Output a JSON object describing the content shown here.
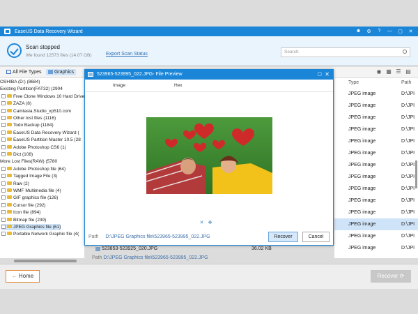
{
  "window": {
    "title": "EaseUS Data Recovery Wizard",
    "controls": [
      "☻",
      "⚙",
      "?",
      "—",
      "▢",
      "✕"
    ]
  },
  "scan": {
    "status": "Scan stopped",
    "summary": "We found 12573 files (14.07 GB)",
    "export_label": "Export Scan Status"
  },
  "search": {
    "placeholder": "Search"
  },
  "tabs": {
    "all": "All File Types",
    "graphics": "Graphics"
  },
  "tree": [
    {
      "label": "OSHIBA (D:) (8684)",
      "level": 0,
      "folder": false
    },
    {
      "label": "Existing Partition(FAT32) (2904",
      "level": 0,
      "folder": false
    },
    {
      "label": "Free Clone Windows 10 Hard Drive t",
      "level": 2,
      "folder": true
    },
    {
      "label": "ZAZA (8)",
      "level": 2,
      "folder": true
    },
    {
      "label": "Camtasia.Studio_xp510.com",
      "level": 2,
      "folder": true
    },
    {
      "label": "Other lost files (1116)",
      "level": 2,
      "folder": true
    },
    {
      "label": "Todo Backup (1184)",
      "level": 2,
      "folder": true
    },
    {
      "label": "EaseUS Data Recovery Wizard (",
      "level": 2,
      "folder": true
    },
    {
      "label": "EaseUS Partition Master 10.5 (28",
      "level": 2,
      "folder": true
    },
    {
      "label": "Adobe Photoshop CS6 (1(",
      "level": 2,
      "folder": true
    },
    {
      "label": "Dict (108)",
      "level": 2,
      "folder": true
    },
    {
      "label": "More Lost Files(RAW) (5780",
      "level": 0,
      "folder": false
    },
    {
      "label": "Adobe Photoshop file (64)",
      "level": 2,
      "folder": true
    },
    {
      "label": "Tagged Image File (3)",
      "level": 2,
      "folder": true
    },
    {
      "label": "Raw (2)",
      "level": 2,
      "folder": true
    },
    {
      "label": "WMF Multimedia file (4)",
      "level": 2,
      "folder": true
    },
    {
      "label": "GIF graphics file (126)",
      "level": 2,
      "folder": true
    },
    {
      "label": "Cursor file (292)",
      "level": 2,
      "folder": true
    },
    {
      "label": "Icon file (894)",
      "level": 2,
      "folder": true
    },
    {
      "label": "Bitmap file (239)",
      "level": 2,
      "folder": true
    },
    {
      "label": "JPEG Graphics file (61)",
      "level": 2,
      "folder": true,
      "selected": true
    },
    {
      "label": "Portable Network Graphic file (4(",
      "level": 2,
      "folder": true
    }
  ],
  "list": {
    "col_type": "Type",
    "col_path": "Path",
    "rows": [
      {
        "type": "JPEG image",
        "path": "D:\\JPI"
      },
      {
        "type": "JPEG image",
        "path": "D:\\JPI"
      },
      {
        "type": "JPEG image",
        "path": "D:\\JPI"
      },
      {
        "type": "JPEG image",
        "path": "D:\\JPI"
      },
      {
        "type": "JPEG image",
        "path": "D:\\JPI"
      },
      {
        "type": "JPEG image",
        "path": "D:\\JPI"
      },
      {
        "type": "JPEG image",
        "path": "D:\\JPI"
      },
      {
        "type": "JPEG image",
        "path": "D:\\JPI"
      },
      {
        "type": "JPEG image",
        "path": "D:\\JPI"
      },
      {
        "type": "JPEG image",
        "path": "D:\\JPI"
      },
      {
        "type": "JPEG image",
        "path": "D:\\JPI"
      },
      {
        "type": "JPEG image",
        "path": "D:\\JPI",
        "selected": true
      },
      {
        "type": "JPEG image",
        "path": "D:\\JPI"
      },
      {
        "type": "JPEG image",
        "path": "D:\\JPI"
      }
    ]
  },
  "behind_row": {
    "name": "523853-523925_020.JPG",
    "size": "36.02 KB"
  },
  "bottom_path": {
    "label": "Path",
    "value": "D:\\JPEG Graphics file\\523965-523995_022.JPG"
  },
  "preview": {
    "title": "523965-523995_022.JPG- File Preview",
    "tab_image": "Image",
    "tab_hex": "Hex",
    "path_label": "Path",
    "path_value": "D:\\JPEG Graphics file\\523965-523995_022.JPG",
    "recover_label": "Recover",
    "cancel_label": "Cancel"
  },
  "footer": {
    "home_label": "Home",
    "recover_label": "Recover"
  }
}
